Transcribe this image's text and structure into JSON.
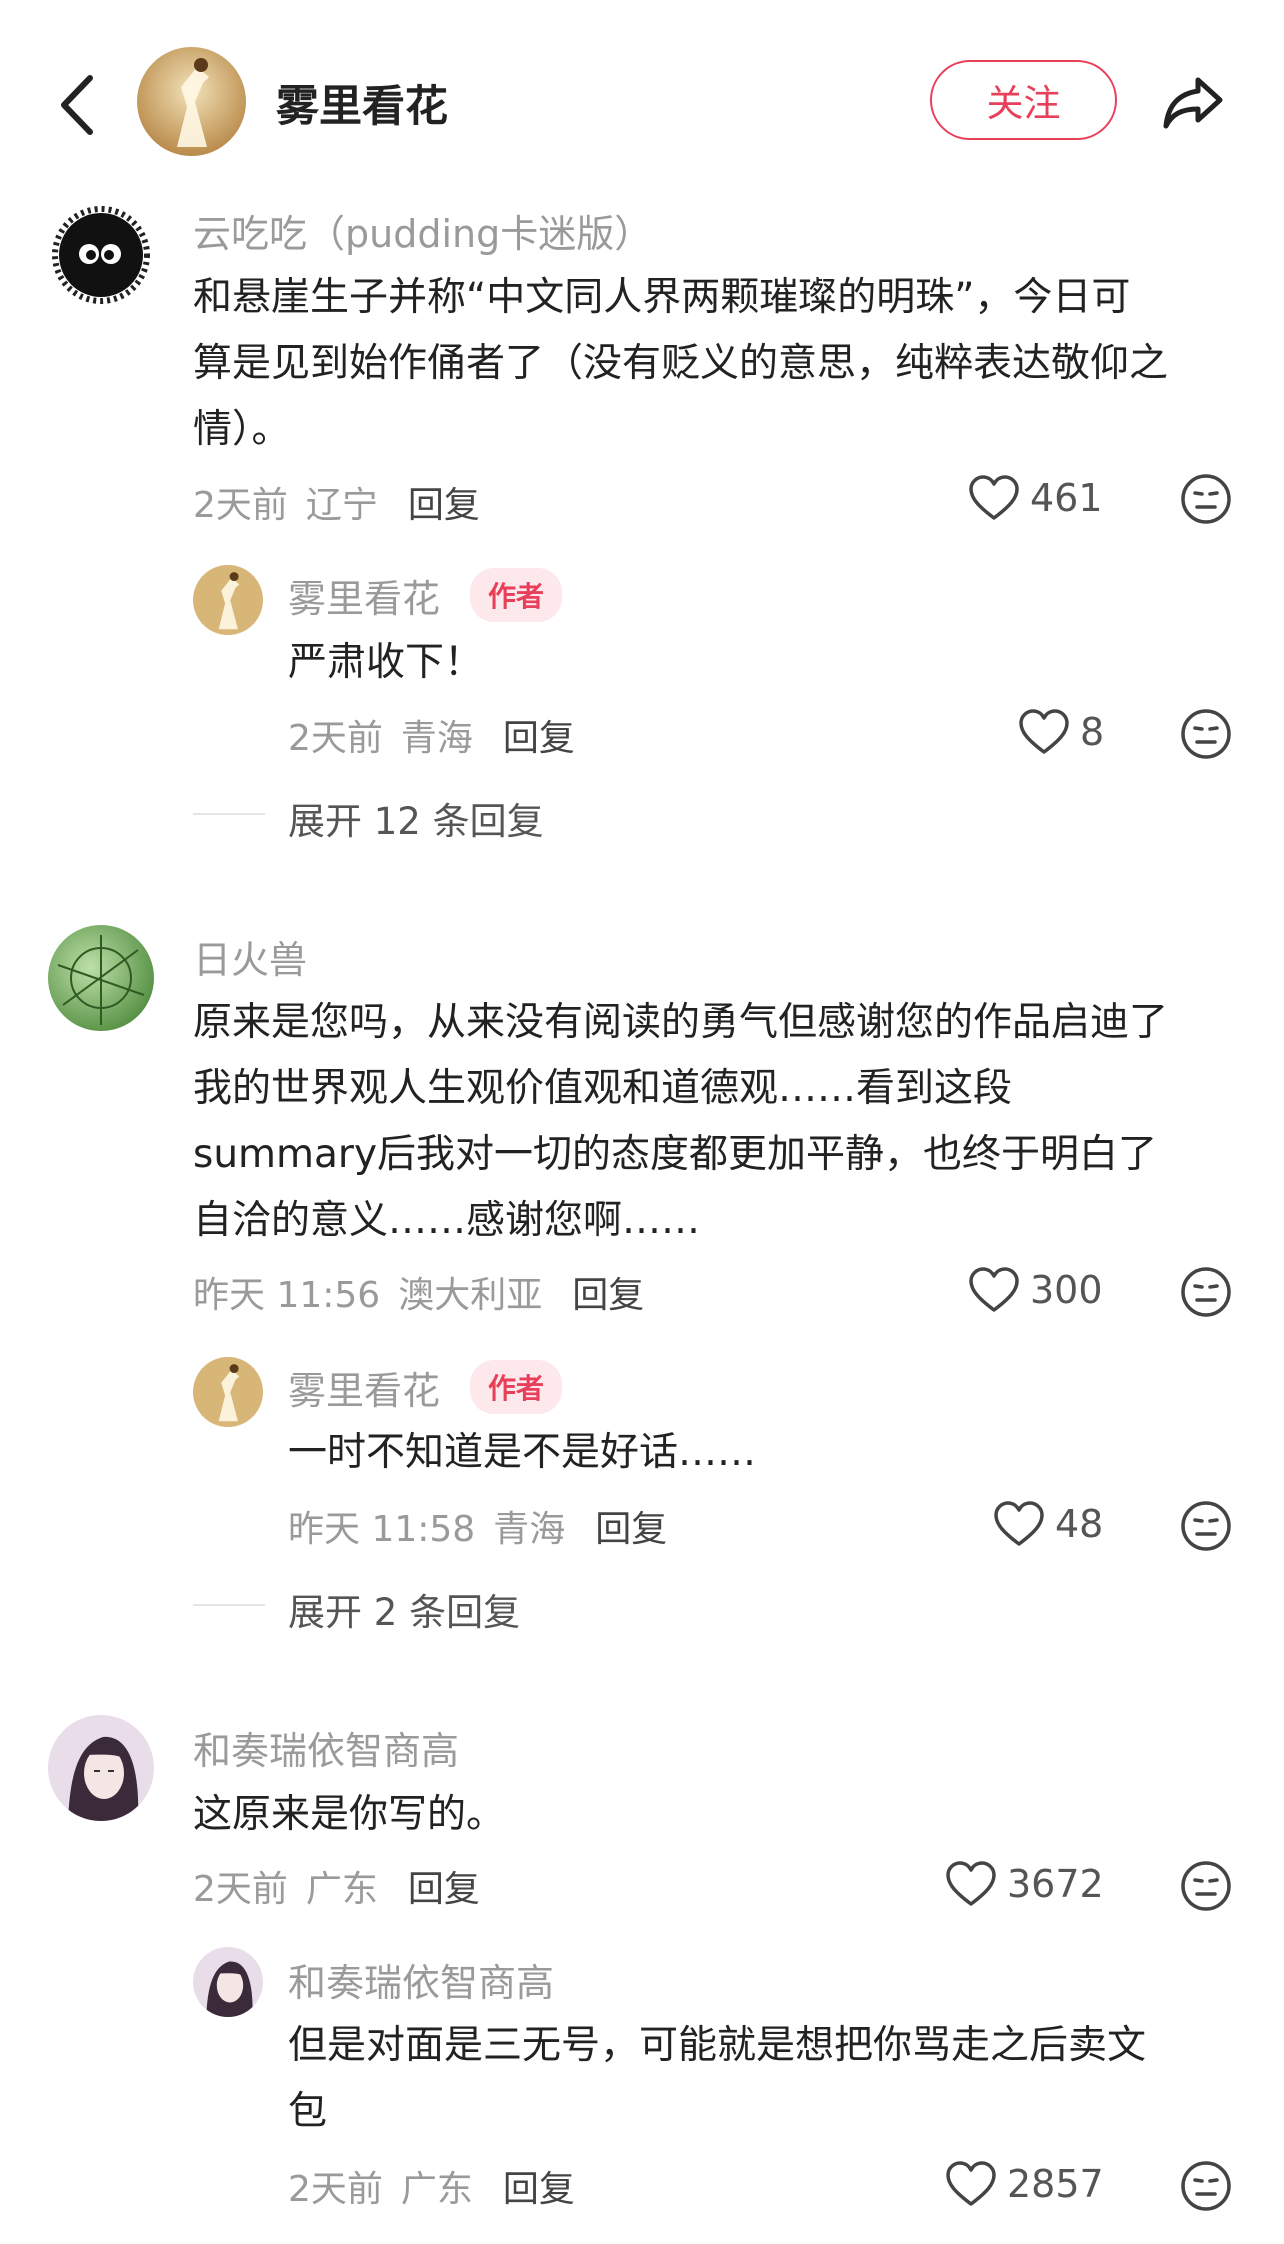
{
  "header": {
    "title": "雾里看花",
    "follow_label": "关注"
  },
  "comments": [
    {
      "user": "云吃吃（pudding卡迷版）",
      "text_lines": [
        "和悬崖生子并称“中文同人界两颗璀璨的明珠”，今日可",
        "算是见到始作俑者了（没有贬义的意思，纯粹表达敬仰之",
        "情）。"
      ],
      "time": "2天前",
      "region": "辽宁",
      "reply_label": "回复",
      "likes": "461",
      "sub_reply": {
        "user": "雾里看花",
        "badge": "作者",
        "text": "严肃收下！",
        "time": "2天前",
        "region": "青海",
        "reply_label": "回复",
        "likes": "8"
      },
      "expand_label": "展开 12 条回复"
    },
    {
      "user": "日火兽",
      "text_lines": [
        "原来是您吗，从来没有阅读的勇气但感谢您的作品启迪了",
        "我的世界观人生观价值观和道德观……看到这段",
        "summary后我对一切的态度都更加平静，也终于明白了",
        "自洽的意义……感谢您啊……"
      ],
      "time": "昨天 11:56",
      "region": "澳大利亚",
      "reply_label": "回复",
      "likes": "300",
      "sub_reply": {
        "user": "雾里看花",
        "badge": "作者",
        "text": "一时不知道是不是好话……",
        "time": "昨天 11:58",
        "region": "青海",
        "reply_label": "回复",
        "likes": "48"
      },
      "expand_label": "展开 2 条回复"
    },
    {
      "user": "和奏瑞依智商高",
      "text_lines": [
        "这原来是你写的。"
      ],
      "time": "2天前",
      "region": "广东",
      "reply_label": "回复",
      "likes": "3672",
      "sub_reply": {
        "user": "和奏瑞依智商高",
        "text_lines": [
          "但是对面是三无号，可能就是想把你骂走之后卖文",
          "包"
        ],
        "time": "2天前",
        "region": "广东",
        "reply_label": "回复",
        "likes": "2857"
      }
    }
  ],
  "colors": {
    "accent": "#e8405a",
    "muted_text": "#9a9a9a",
    "badge_bg": "#fde8ec"
  },
  "icons": [
    "back-arrow-icon",
    "share-icon",
    "heart-icon",
    "neutral-face-icon"
  ]
}
